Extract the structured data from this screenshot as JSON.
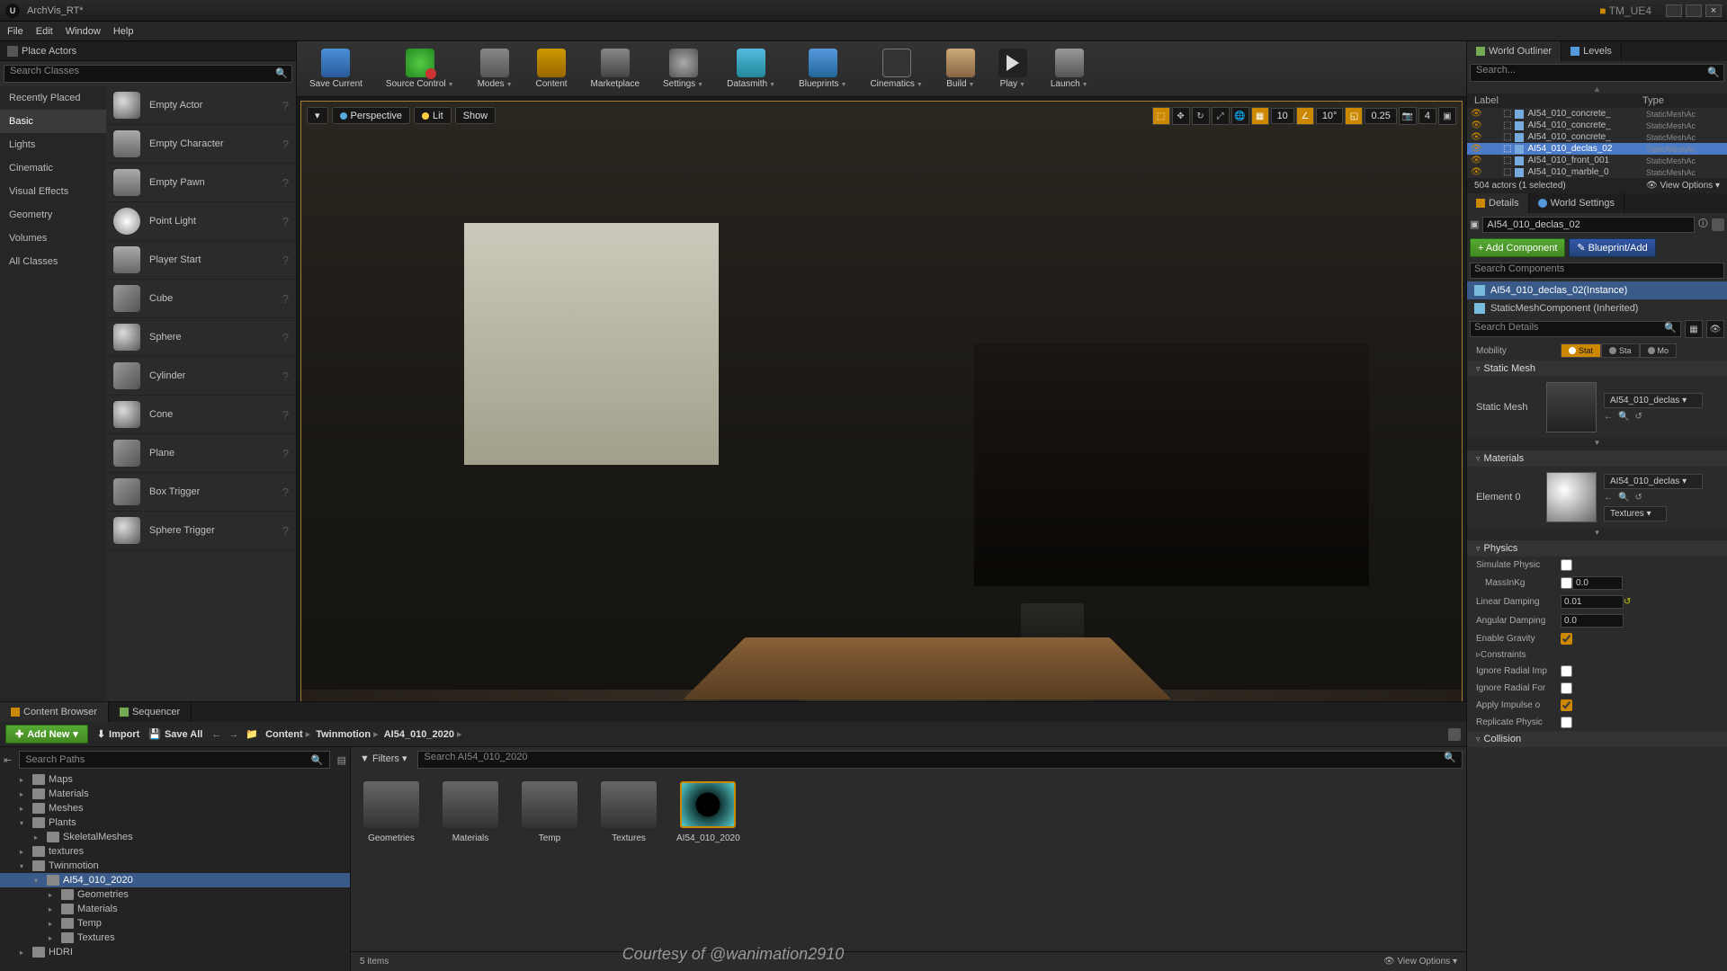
{
  "titlebar": {
    "title": "ArchVis_RT*",
    "project": "TM_UE4"
  },
  "menubar": [
    "File",
    "Edit",
    "Window",
    "Help"
  ],
  "place_actors": {
    "title": "Place Actors",
    "search_placeholder": "Search Classes",
    "categories": [
      "Recently Placed",
      "Basic",
      "Lights",
      "Cinematic",
      "Visual Effects",
      "Geometry",
      "Volumes",
      "All Classes"
    ],
    "active_category": "Basic",
    "actors": [
      "Empty Actor",
      "Empty Character",
      "Empty Pawn",
      "Point Light",
      "Player Start",
      "Cube",
      "Sphere",
      "Cylinder",
      "Cone",
      "Plane",
      "Box Trigger",
      "Sphere Trigger"
    ]
  },
  "toolbar": [
    {
      "label": "Save Current",
      "icon": "ic-save",
      "drop": false
    },
    {
      "label": "Source Control",
      "icon": "ic-src",
      "drop": true
    },
    {
      "label": "Modes",
      "icon": "ic-modes",
      "drop": true
    },
    {
      "label": "Content",
      "icon": "ic-content",
      "drop": false
    },
    {
      "label": "Marketplace",
      "icon": "ic-market",
      "drop": false
    },
    {
      "label": "Settings",
      "icon": "ic-settings",
      "drop": true
    },
    {
      "label": "Datasmith",
      "icon": "ic-ds",
      "drop": true
    },
    {
      "label": "Blueprints",
      "icon": "ic-bp",
      "drop": true
    },
    {
      "label": "Cinematics",
      "icon": "ic-cine",
      "drop": true
    },
    {
      "label": "Build",
      "icon": "ic-build",
      "drop": true
    },
    {
      "label": "Play",
      "icon": "ic-play",
      "drop": true
    },
    {
      "label": "Launch",
      "icon": "ic-launch",
      "drop": true
    }
  ],
  "viewport": {
    "mode": "Perspective",
    "lit": "Lit",
    "show": "Show",
    "snap_pos": "10",
    "snap_rot": "10°",
    "snap_scale": "0.25",
    "cam_speed": "4"
  },
  "outliner": {
    "tab1": "World Outliner",
    "tab2": "Levels",
    "search_placeholder": "Search...",
    "col_label": "Label",
    "col_type": "Type",
    "rows": [
      {
        "name": "AI54_010_concrete_",
        "type": "StaticMeshAc",
        "sel": false
      },
      {
        "name": "AI54_010_concrete_",
        "type": "StaticMeshAc",
        "sel": false
      },
      {
        "name": "AI54_010_concrete_",
        "type": "StaticMeshAc",
        "sel": false
      },
      {
        "name": "AI54_010_declas_02",
        "type": "StaticMeshAc",
        "sel": true
      },
      {
        "name": "AI54_010_front_001",
        "type": "StaticMeshAc",
        "sel": false
      },
      {
        "name": "AI54_010_marble_0",
        "type": "StaticMeshAc",
        "sel": false
      }
    ],
    "status": "504 actors (1 selected)",
    "view_opts": "View Options"
  },
  "details": {
    "tab1": "Details",
    "tab2": "World Settings",
    "actor_name": "AI54_010_declas_02",
    "add_component": "+ Add Component",
    "blueprint_add": "Blueprint/Add",
    "search_components": "Search Components",
    "instance": "AI54_010_declas_02(Instance)",
    "static_mesh_comp": "StaticMeshComponent (Inherited)",
    "search_details": "Search Details",
    "mobility_label": "Mobility",
    "mobility_opts": [
      "Stat",
      "Sta",
      "Mo"
    ],
    "sections": {
      "static_mesh": {
        "title": "Static Mesh",
        "prop": "Static Mesh",
        "value": "AI54_010_declas"
      },
      "materials": {
        "title": "Materials",
        "prop": "Element 0",
        "value": "AI54_010_declas",
        "textures": "Textures"
      },
      "physics": {
        "title": "Physics",
        "simulate": "Simulate Physic",
        "mass": "MassInKg",
        "mass_val": "0.0",
        "lin_damp": "Linear Damping",
        "lin_val": "0.01",
        "ang_damp": "Angular Damping",
        "ang_val": "0.0",
        "gravity": "Enable Gravity",
        "constraints": "Constraints",
        "ign_imp": "Ignore Radial Imp",
        "ign_for": "Ignore Radial For",
        "apply_imp": "Apply Impulse o",
        "replicate": "Replicate Physic"
      },
      "collision": "Collision"
    }
  },
  "content_browser": {
    "tab1": "Content Browser",
    "tab2": "Sequencer",
    "add_new": "Add New",
    "import": "Import",
    "save_all": "Save All",
    "breadcrumb": [
      "Content",
      "Twinmotion",
      "AI54_010_2020"
    ],
    "tree_search": "Search Paths",
    "tree": [
      {
        "label": "Maps",
        "depth": 1
      },
      {
        "label": "Materials",
        "depth": 1
      },
      {
        "label": "Meshes",
        "depth": 1
      },
      {
        "label": "Plants",
        "depth": 1,
        "exp": true
      },
      {
        "label": "SkeletalMeshes",
        "depth": 2
      },
      {
        "label": "textures",
        "depth": 1
      },
      {
        "label": "Twinmotion",
        "depth": 1,
        "exp": true
      },
      {
        "label": "AI54_010_2020",
        "depth": 2,
        "sel": true,
        "exp": true
      },
      {
        "label": "Geometries",
        "depth": 3
      },
      {
        "label": "Materials",
        "depth": 3
      },
      {
        "label": "Temp",
        "depth": 3
      },
      {
        "label": "Textures",
        "depth": 3
      },
      {
        "label": "HDRI",
        "depth": 1
      }
    ],
    "filters": "Filters",
    "content_search": "Search AI54_010_2020",
    "items": [
      {
        "label": "Geometries",
        "type": "folder"
      },
      {
        "label": "Materials",
        "type": "folder"
      },
      {
        "label": "Temp",
        "type": "folder"
      },
      {
        "label": "Textures",
        "type": "folder"
      },
      {
        "label": "AI54_010_2020",
        "type": "tex"
      }
    ],
    "count": "5 items",
    "view_opts": "View Options"
  },
  "courtesy": "Courtesy of @wanimation2910"
}
